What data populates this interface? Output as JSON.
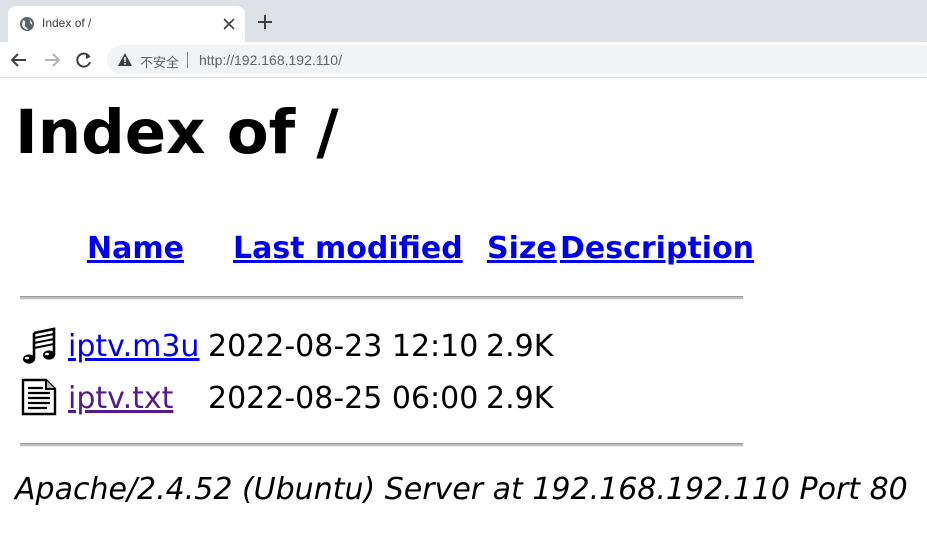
{
  "browser": {
    "tab_title": "Index of /",
    "security_label": "不安全",
    "url": "http://192.168.192.110/"
  },
  "page": {
    "title": "Index of /",
    "columns": [
      "Name",
      "Last modified",
      "Size",
      "Description"
    ],
    "files": [
      {
        "name": "iptv.m3u",
        "modified": "2022-08-23 12:10",
        "size": "2.9K",
        "icon": "audio-file-icon"
      },
      {
        "name": "iptv.txt",
        "modified": "2022-08-25 06:00",
        "size": "2.9K",
        "icon": "text-file-icon"
      }
    ],
    "footer": "Apache/2.4.52 (Ubuntu) Server at 192.168.192.110 Port 80"
  },
  "colors": {
    "link": "#0000ee",
    "visited": "#551a8b"
  }
}
